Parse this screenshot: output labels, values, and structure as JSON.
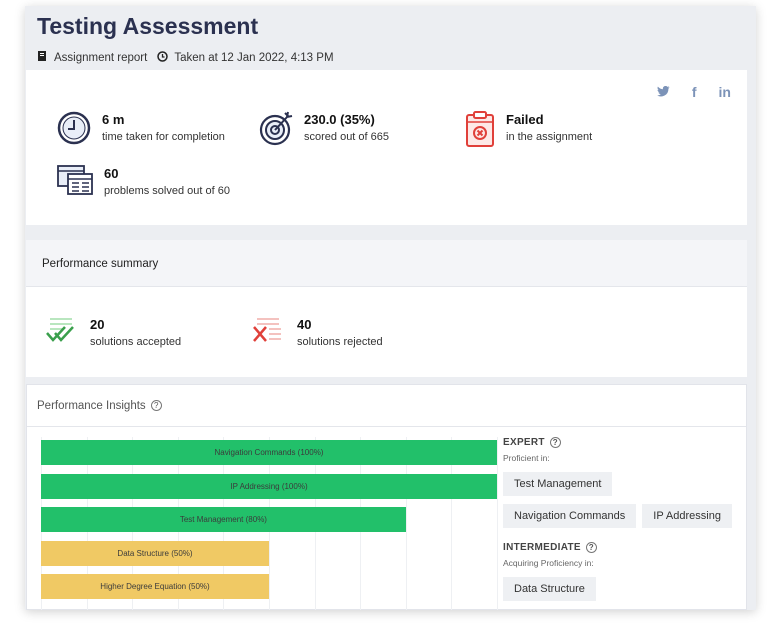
{
  "header": {
    "title": "Testing Assessment",
    "report_label": "Assignment report",
    "taken_label": "Taken at 12 Jan 2022, 4:13 PM"
  },
  "social": {
    "icons": [
      "twitter-icon",
      "facebook-icon",
      "linkedin-icon"
    ],
    "twitter": "⁄",
    "facebook": "f",
    "linkedin": "in"
  },
  "stats": {
    "time": {
      "value": "6 m",
      "label": "time taken for completion"
    },
    "score": {
      "value": "230.0 (35%)",
      "label": "scored out of 665"
    },
    "result": {
      "value": "Failed",
      "label": "in the assignment"
    },
    "problems": {
      "value": "60",
      "label": "problems solved out of 60"
    }
  },
  "performance_summary": {
    "title": "Performance summary",
    "accepted": {
      "value": "20",
      "label": "solutions accepted"
    },
    "rejected": {
      "value": "40",
      "label": "solutions rejected"
    }
  },
  "insights": {
    "title": "Performance Insights",
    "expert": {
      "label": "EXPERT",
      "sub": "Proficient in:",
      "tags": [
        "Test Management",
        "Navigation Commands",
        "IP Addressing"
      ]
    },
    "intermediate": {
      "label": "INTERMEDIATE",
      "sub": "Acquiring Proficiency in:",
      "tags": [
        "Data Structure"
      ]
    }
  },
  "chart_data": {
    "type": "bar",
    "orientation": "horizontal",
    "categories": [
      "Navigation Commands (100%)",
      "IP Addressing (100%)",
      "Test Management (80%)",
      "Data Structure (50%)",
      "Higher Degree Equation (50%)"
    ],
    "values": [
      100,
      100,
      80,
      50,
      50
    ],
    "xlim": [
      0,
      100
    ],
    "colors": [
      "#22c06a",
      "#22c06a",
      "#22c06a",
      "#f0c964",
      "#f0c964"
    ]
  },
  "colors": {
    "expert": "#22c06a",
    "intermediate": "#f0c964",
    "accent": "#2b3150"
  }
}
